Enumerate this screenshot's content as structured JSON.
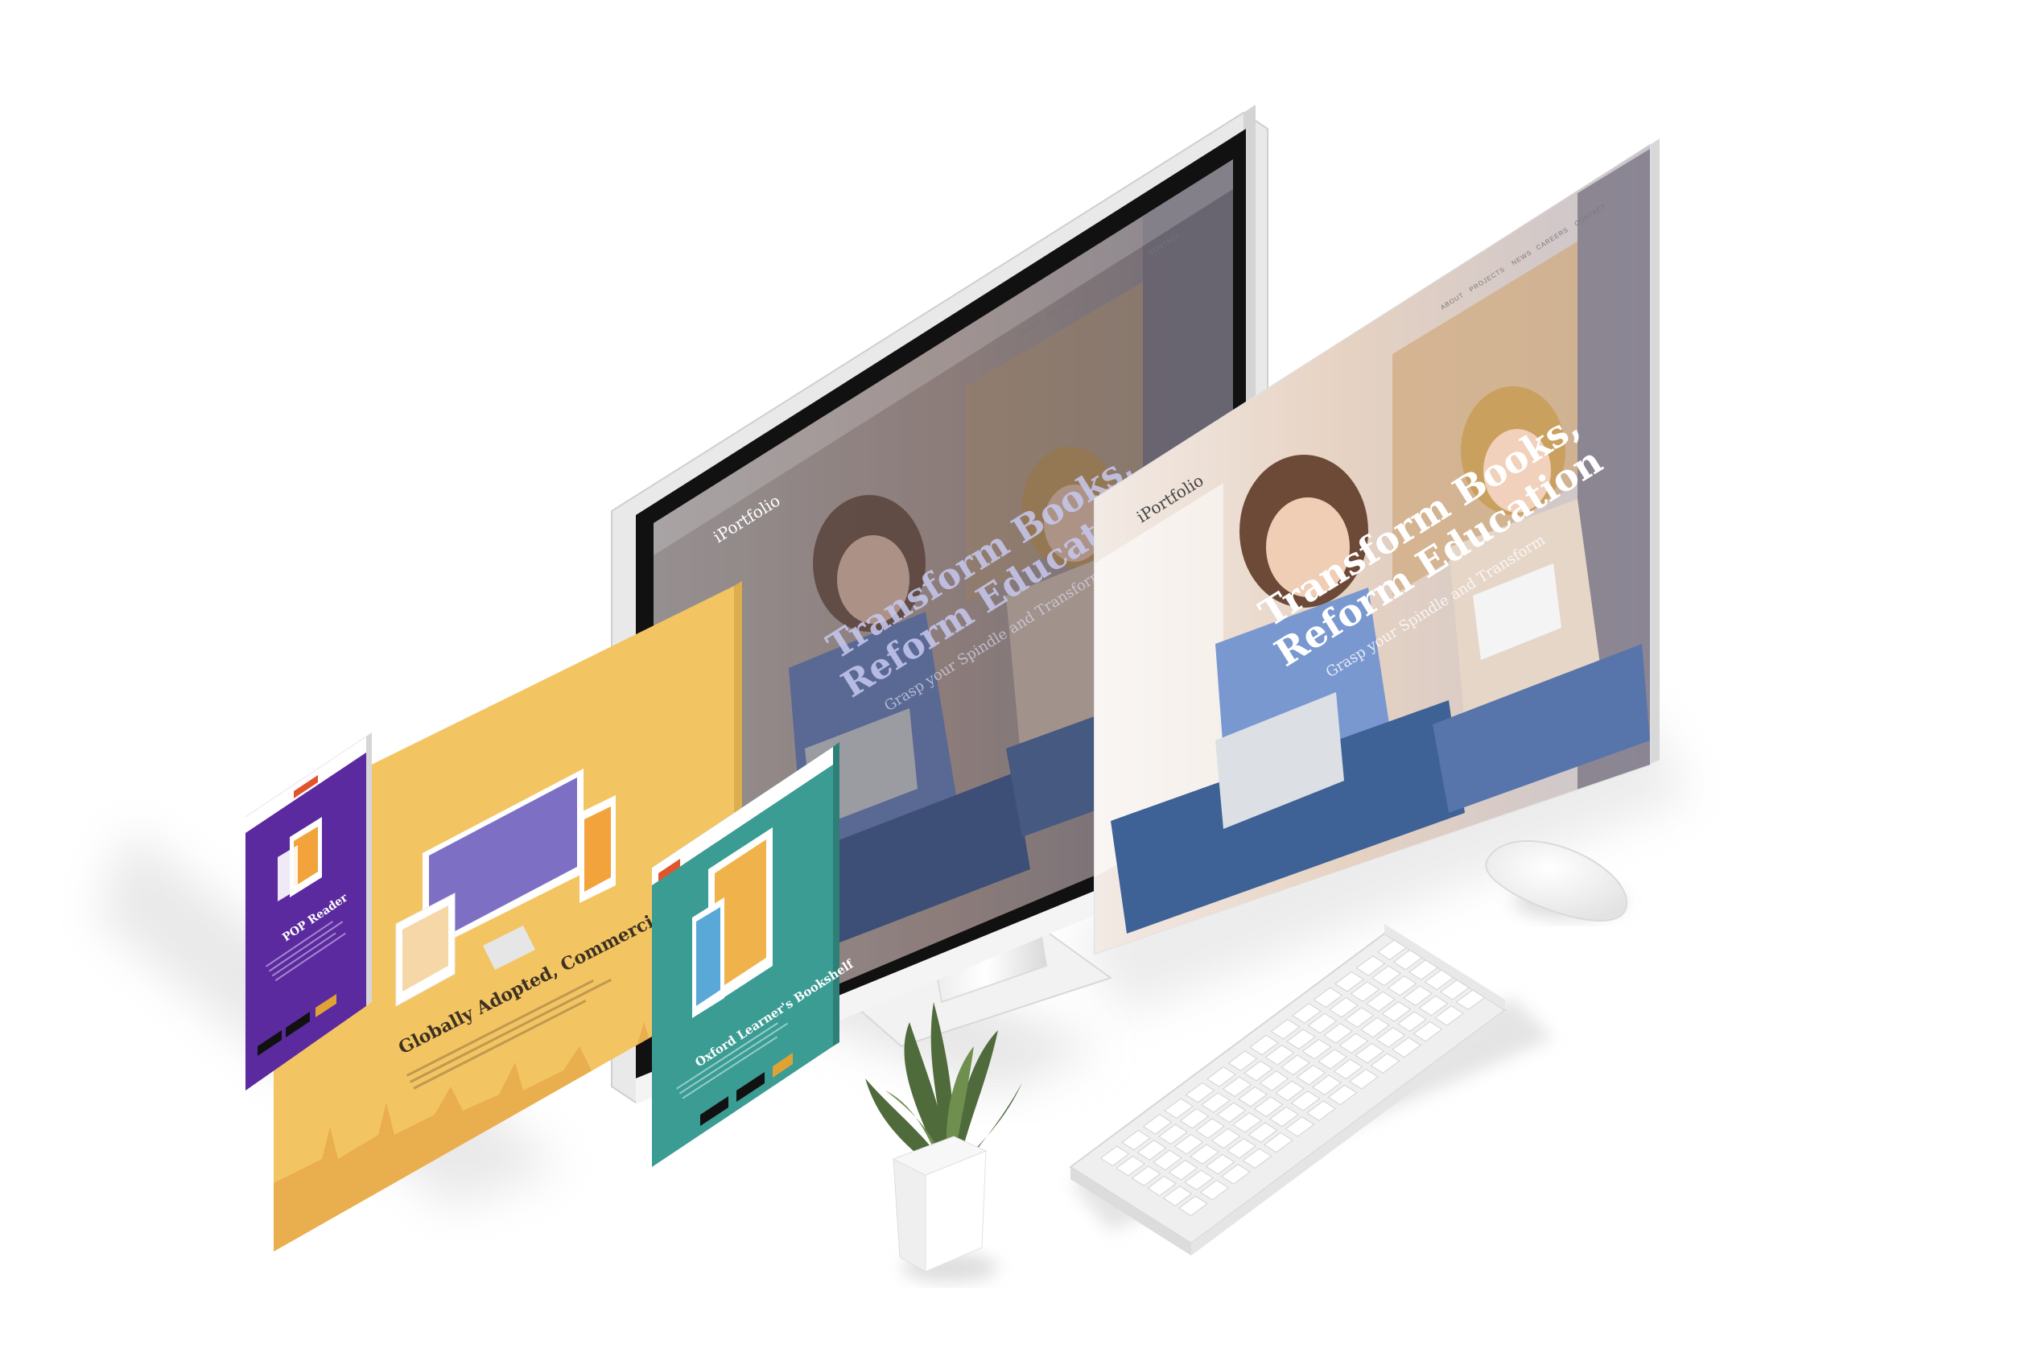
{
  "brand": "iPortfolio",
  "nav_items": [
    "ABOUT",
    "PROJECTS",
    "NEWS",
    "CAREERS",
    "CONTACT"
  ],
  "hero": {
    "title_line1": "Transform Books,",
    "title_line2": "Reform Education",
    "subtitle": "Grasp your Spindle and Transform"
  },
  "yellow_panel": {
    "title": "Globally Adopted, Commercially Proven"
  },
  "purple_panel": {
    "title": "POP Reader"
  },
  "teal_panel": {
    "title": "Oxford Learner's Bookshelf"
  },
  "colors": {
    "yellow": "#f3c462",
    "purple": "#5b2a9e",
    "teal": "#3a9c93",
    "hero_blue": "#6f74c7",
    "accent_red": "#e0552d"
  },
  "icons": [
    "monitor",
    "keyboard",
    "mouse",
    "plant",
    "photo-hero",
    "app-store-badge",
    "google-play-badge"
  ]
}
